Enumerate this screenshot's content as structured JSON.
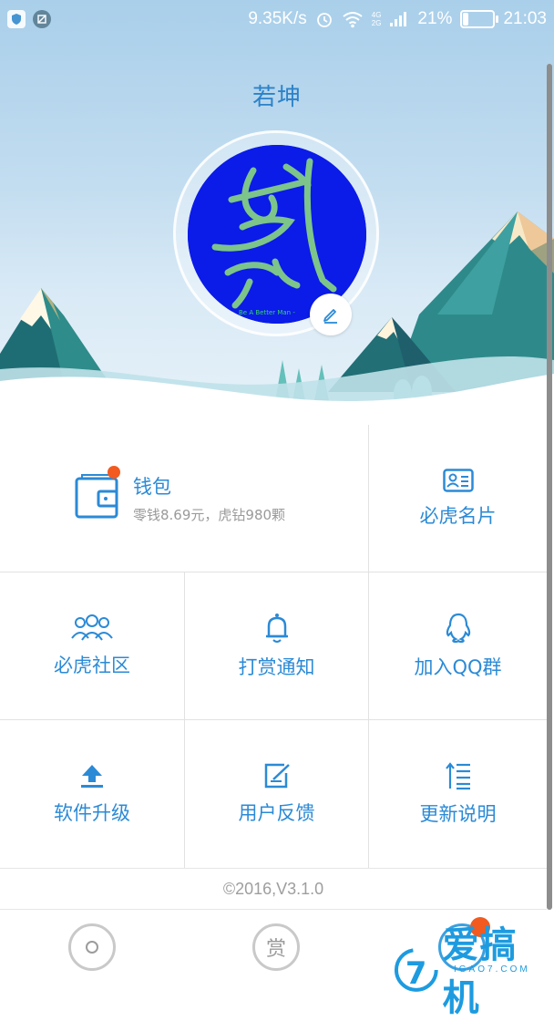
{
  "status_bar": {
    "net_speed": "9.35K/s",
    "network_label": "4G",
    "network_label2": "2G",
    "battery": "21%",
    "battery_level": 0.21,
    "time": "21:03"
  },
  "profile": {
    "name": "若坤",
    "avatar_caption": "Be A Better Man - "
  },
  "wallet": {
    "title": "钱包",
    "subtitle": "零钱8.69元，虎钻980颗",
    "has_badge": true
  },
  "menu": [
    {
      "label": "必虎名片",
      "icon": "id-card-icon"
    },
    {
      "label": "必虎社区",
      "icon": "community-icon"
    },
    {
      "label": "打赏通知",
      "icon": "bell-icon"
    },
    {
      "label": "加入QQ群",
      "icon": "qq-penguin-icon"
    },
    {
      "label": "软件升级",
      "icon": "upgrade-icon"
    },
    {
      "label": "用户反馈",
      "icon": "feedback-icon"
    },
    {
      "label": "更新说明",
      "icon": "changelog-icon"
    }
  ],
  "version": "©2016,V3.1.0",
  "tabbar": {
    "reward_label": "赏"
  },
  "watermark": {
    "brand": "爱搞机",
    "site": "IGAO7.COM"
  },
  "colors": {
    "accent": "#2b8ad6",
    "badge": "#f25a1f",
    "sky_top": "#a9cfea",
    "avatar_bg": "#0b1be8"
  }
}
